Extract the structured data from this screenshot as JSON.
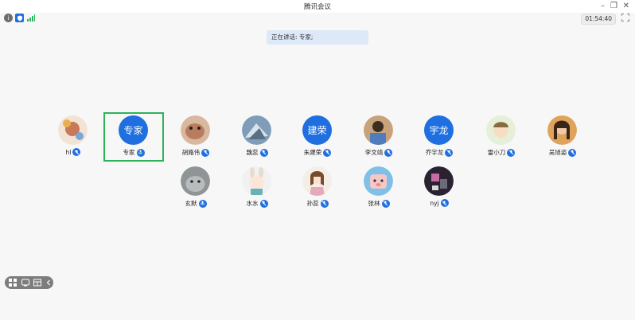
{
  "window": {
    "title": "腾讯会议"
  },
  "toolbar": {
    "icons": [
      "info-icon",
      "shield-icon",
      "signal-icon"
    ],
    "timer": "01:54:40"
  },
  "speaking": {
    "text": "正在讲话: 专家;"
  },
  "participants": [
    {
      "name": "hl",
      "avatar": "photo",
      "mic": "off"
    },
    {
      "name": "专家",
      "avatar": "text",
      "avatar_text": "专家",
      "mic": "speaking",
      "active": true
    },
    {
      "name": "胡路伟",
      "avatar": "photo",
      "mic": "off"
    },
    {
      "name": "魏蕊",
      "avatar": "photo",
      "mic": "off"
    },
    {
      "name": "朱建荣",
      "avatar": "text",
      "avatar_text": "建荣",
      "mic": "off"
    },
    {
      "name": "李文靖",
      "avatar": "photo",
      "mic": "off"
    },
    {
      "name": "乔宇龙",
      "avatar": "text",
      "avatar_text": "宇龙",
      "mic": "off"
    },
    {
      "name": "雷小刀",
      "avatar": "photo",
      "mic": "off"
    },
    {
      "name": "吴旭姿",
      "avatar": "photo",
      "mic": "off"
    },
    {
      "name": "玄默",
      "avatar": "photo",
      "mic": "on"
    },
    {
      "name": "水水",
      "avatar": "photo",
      "mic": "off"
    },
    {
      "name": "孙蕊",
      "avatar": "photo",
      "mic": "off"
    },
    {
      "name": "张林",
      "avatar": "photo",
      "mic": "off"
    },
    {
      "name": "nyj",
      "avatar": "photo",
      "mic": "off"
    }
  ],
  "bottom_toolbar": {
    "icons": [
      "grid-view-icon",
      "meeting-icon",
      "layout-icon",
      "collapse-icon"
    ]
  },
  "colors": {
    "accent": "#1f6fe0",
    "active_border": "#2db35a",
    "speaking_bg": "#dde9f8"
  }
}
